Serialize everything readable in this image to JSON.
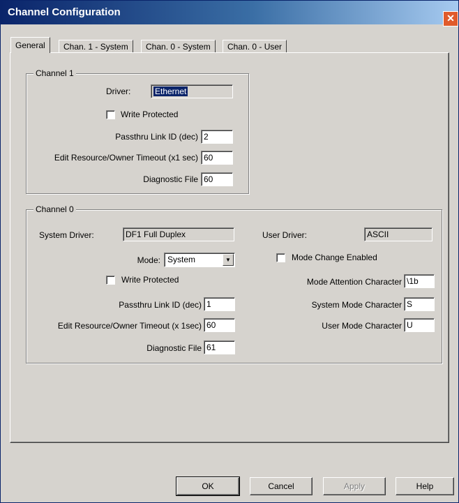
{
  "window": {
    "title": "Channel Configuration",
    "close_glyph": "✕"
  },
  "tabs": [
    {
      "label": "General",
      "active": true
    },
    {
      "label": "Chan. 1 - System",
      "active": false
    },
    {
      "label": "Chan. 0 - System",
      "active": false
    },
    {
      "label": "Chan. 0 - User",
      "active": false
    }
  ],
  "channel1": {
    "title": "Channel 1",
    "driver_label": "Driver:",
    "driver_value": "Ethernet",
    "write_protected_label": "Write Protected",
    "write_protected_checked": false,
    "passthru_label": "Passthru Link ID (dec)",
    "passthru_value": "2",
    "timeout_label": "Edit Resource/Owner Timeout (x1 sec)",
    "timeout_value": "60",
    "diag_label": "Diagnostic File",
    "diag_value": "60"
  },
  "channel0": {
    "title": "Channel 0",
    "system_driver_label": "System Driver:",
    "system_driver_value": "DF1 Full Duplex",
    "user_driver_label": "User Driver:",
    "user_driver_value": "ASCII",
    "mode_label": "Mode:",
    "mode_value": "System",
    "mode_change_label": "Mode Change Enabled",
    "mode_change_checked": false,
    "write_protected_label": "Write Protected",
    "write_protected_checked": false,
    "mode_attention_label": "Mode Attention Character",
    "mode_attention_value": "\\1b",
    "passthru_label": "Passthru Link ID (dec)",
    "passthru_value": "1",
    "system_mode_char_label": "System Mode Character",
    "system_mode_char_value": "S",
    "timeout_label": "Edit Resource/Owner Timeout (x 1sec)",
    "timeout_value": "60",
    "user_mode_char_label": "User Mode Character",
    "user_mode_char_value": "U",
    "diag_label": "Diagnostic File",
    "diag_value": "61"
  },
  "buttons": {
    "ok": "OK",
    "cancel": "Cancel",
    "apply": "Apply",
    "help": "Help"
  },
  "colors": {
    "titlebar_start": "#0a246a",
    "close_button": "#e05a2b",
    "dialog_face": "#d6d3ce"
  },
  "icons": {
    "close": "close-icon",
    "dropdown": "chevron-down-icon"
  }
}
